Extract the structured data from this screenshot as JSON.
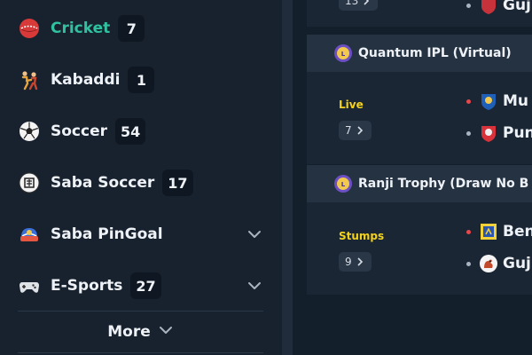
{
  "sidebar": {
    "items": [
      {
        "label": "Cricket",
        "count": "7",
        "active": true
      },
      {
        "label": "Kabaddi",
        "count": "1"
      },
      {
        "label": "Soccer",
        "count": "54"
      },
      {
        "label": "Saba Soccer",
        "count": "17"
      },
      {
        "label": "Saba PinGoal",
        "count": "",
        "expandable": true
      },
      {
        "label": "E-Sports",
        "count": "27",
        "expandable": true
      }
    ],
    "more_label": "More"
  },
  "main": {
    "top_partial": {
      "more_markets": "13",
      "team": "Guj"
    },
    "leagues": [
      {
        "name": "Quantum IPL (Virtual)",
        "match": {
          "status": "Live",
          "more_markets": "7",
          "home": "Mu",
          "away": "Pun"
        }
      },
      {
        "name": "Ranji Trophy (Draw No B",
        "match": {
          "status": "Stumps",
          "more_markets": "9",
          "home": "Ben",
          "away": "Guj"
        }
      }
    ]
  },
  "colors": {
    "active": "#2fc1a0",
    "status": "#f3d21c",
    "live_dot": "#e4484b",
    "idle_dot": "#aab4c0"
  }
}
